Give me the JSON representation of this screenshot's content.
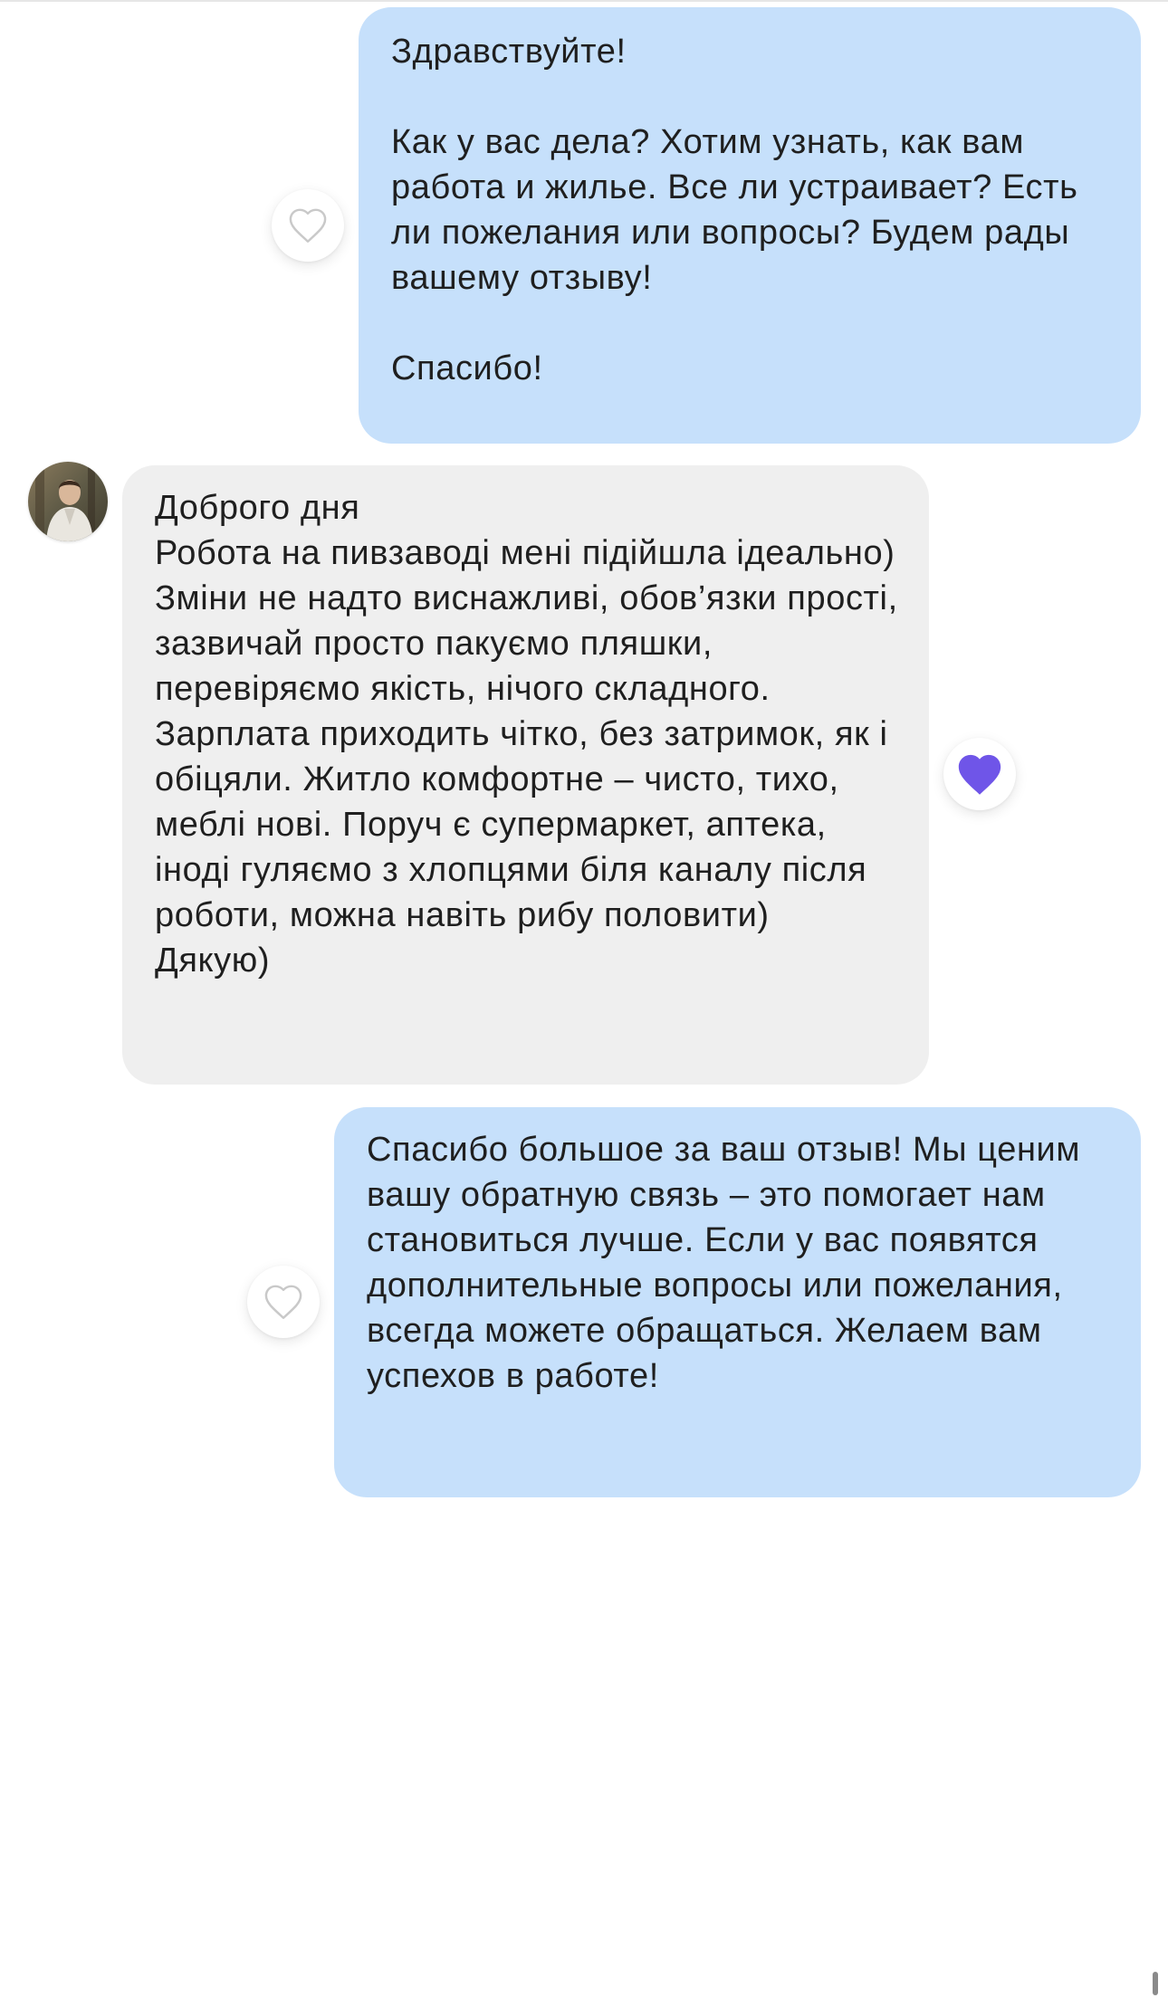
{
  "messages": [
    {
      "direction": "outgoing",
      "text": "Здравствуйте!\n\nКак у вас дела? Хотим узнать, как вам работа и жилье. Все ли устраивает? Есть ли пожелания или вопросы? Будем рады вашему отзыву!\n\nСпасибо!",
      "liked": false
    },
    {
      "direction": "incoming",
      "text": "Доброго дня\nРобота на пивзаводі мені підійшла ідеально) Зміни не надто виснажливі, обов’язки прості, зазвичай просто пакуємо пляшки, перевіряємо якість, нічого складного. Зарплата приходить чітко, без затримок, як і обіцяли. Житло комфортне – чисто, тихо, меблі нові. Поруч є супермаркет, аптека, іноді гуляємо з хлопцями біля каналу після роботи, можна навіть рибу половити)\nДякую)",
      "liked": true
    },
    {
      "direction": "outgoing",
      "text": "Спасибо большое за ваш отзыв! Мы ценим вашу обратную связь – это помогает нам становиться лучше. Если у вас появятся дополнительные вопросы или пожелания, всегда можете обращаться. Желаем вам успехов в работе!",
      "liked": false
    }
  ],
  "icons": {
    "like_empty": "heart-outline-icon",
    "like_filled": "heart-filled-icon"
  },
  "colors": {
    "outgoing_bubble": "#c6e0fb",
    "incoming_bubble": "#efefef",
    "heart_liked": "#6f55e8",
    "heart_outline": "#c9c9c9"
  }
}
